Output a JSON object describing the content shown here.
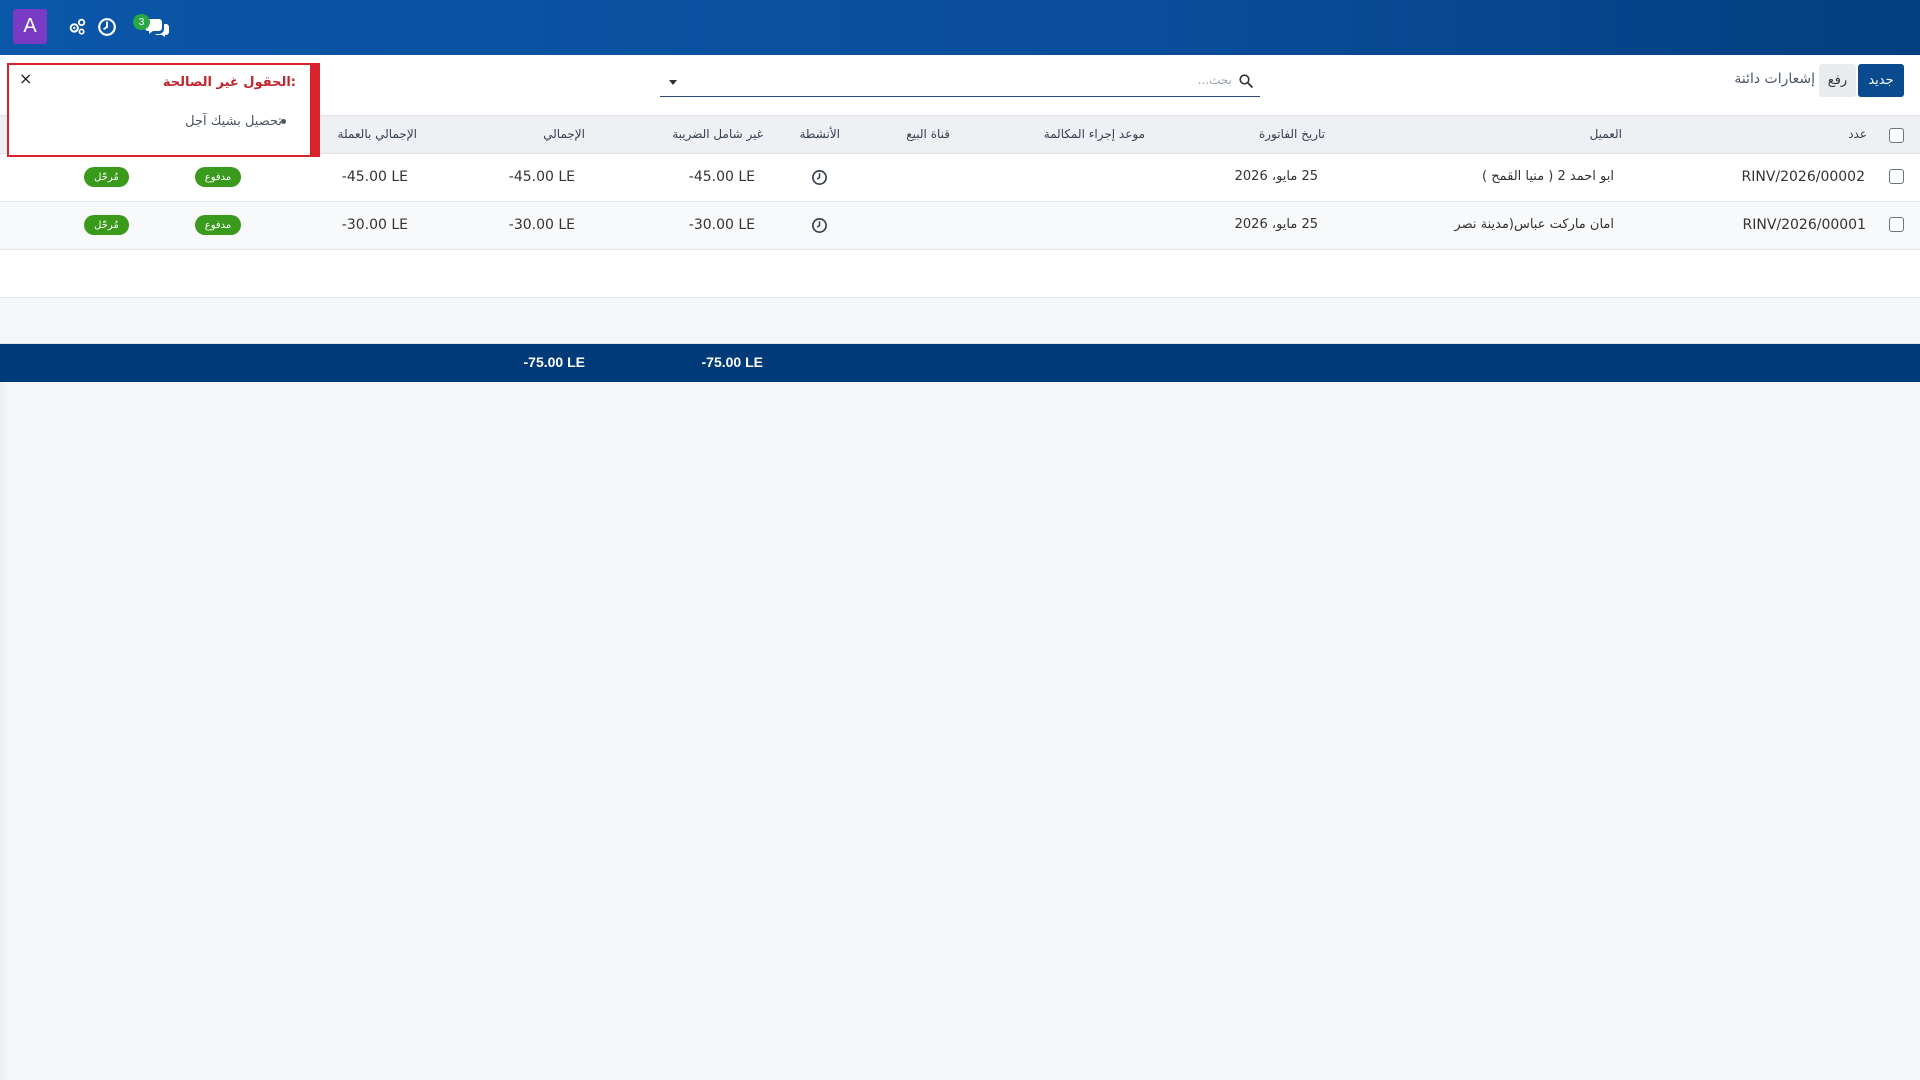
{
  "navbar": {
    "avatar_letter": "A",
    "icons": [
      "settings-icon",
      "clock-icon",
      "chat-icon"
    ],
    "chat_badge": "3"
  },
  "control_panel": {
    "new_label": "جديد",
    "upload_label": "رفع",
    "breadcrumb": "إشعارات دائنة",
    "search_placeholder": "بحث..."
  },
  "table": {
    "headers": {
      "number": "عدد",
      "customer": "العميل",
      "invoice_date": "تاريخ الفاتورة",
      "call_date": "موعد إجراء المكالمة",
      "sales_channel": "قناة البيع",
      "activities": "الأنشطة",
      "untaxed": "غير شامل الضريبة",
      "total": "الإجمالي",
      "total_currency": "الإجمالي بالعملة"
    },
    "rows": [
      {
        "number": "RINV/2026/00002",
        "customer": "ابو احمد 2 ( منيا القمح )",
        "invoice_date": "25 مايو، 2026",
        "untaxed": "-45.00 LE",
        "total": "-45.00 LE",
        "total_currency": "-45.00 LE",
        "payment_status": "مدفوع",
        "state": "مُرحّل"
      },
      {
        "number": "RINV/2026/00001",
        "customer": "امان ماركت عباس(مدينة نصر",
        "invoice_date": "25 مايو، 2026",
        "untaxed": "-30.00 LE",
        "total": "-30.00 LE",
        "total_currency": "-30.00 LE",
        "payment_status": "مدفوع",
        "state": "مُرحّل"
      }
    ],
    "totals": {
      "untaxed": "-75.00 LE",
      "total": "-75.00 LE"
    }
  },
  "notification": {
    "title": "الحقول غير الصالحة:",
    "items": [
      "تحصيل بشيك آجل"
    ],
    "close": "×"
  },
  "colors": {
    "navbar": "#0a4d9a",
    "primary_button": "#0a4a8f",
    "footer": "#003a78",
    "badge": "#3a9a1c",
    "error": "#d9232d",
    "avatar": "#7a3bc4"
  }
}
